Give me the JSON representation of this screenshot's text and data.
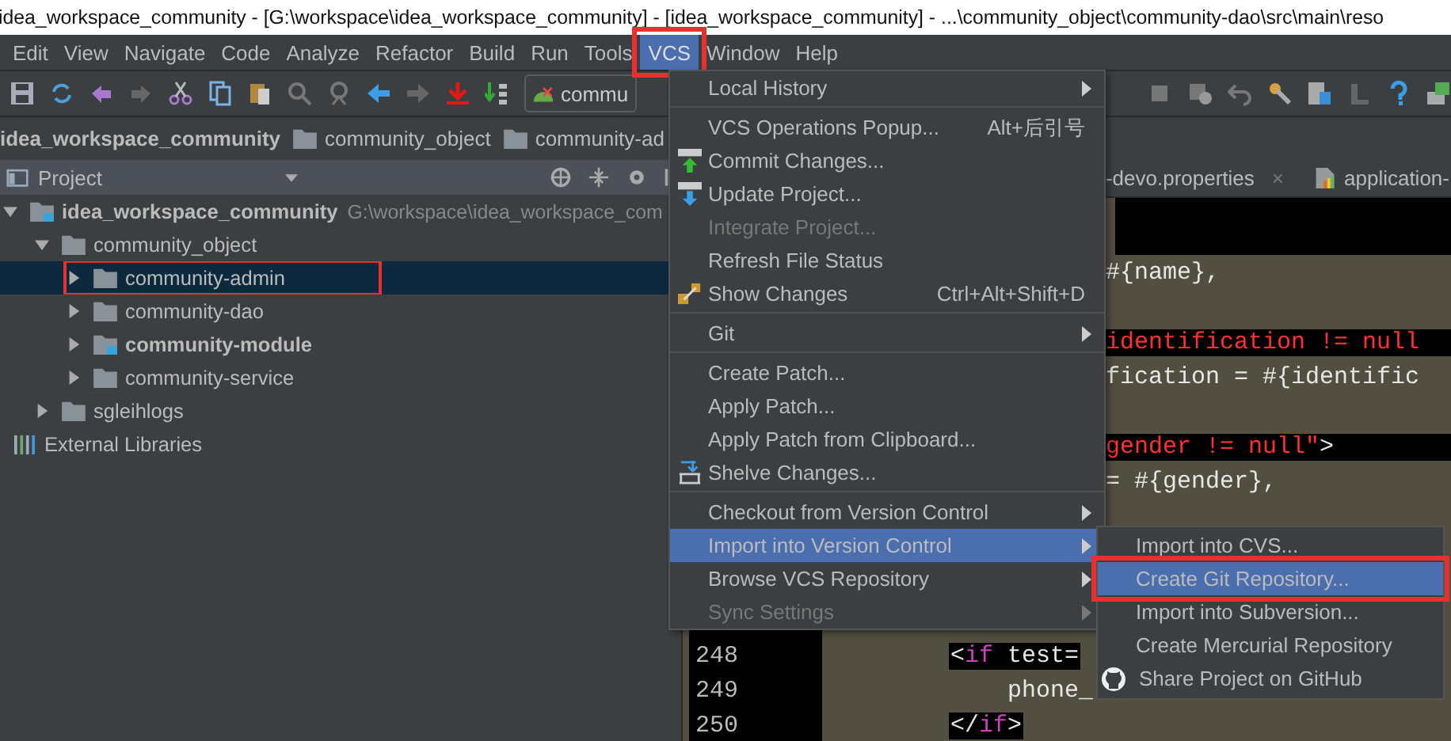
{
  "window": {
    "title": "idea_workspace_community - [G:\\workspace\\idea_workspace_community] - [idea_workspace_community] - ...\\community_object\\community-dao\\src\\main\\reso"
  },
  "menu_bar": [
    {
      "label": "Edit",
      "selected": false,
      "annotated": false
    },
    {
      "label": "View",
      "selected": false,
      "annotated": false
    },
    {
      "label": "Navigate",
      "selected": false,
      "annotated": false
    },
    {
      "label": "Code",
      "selected": false,
      "annotated": false
    },
    {
      "label": "Analyze",
      "selected": false,
      "annotated": false
    },
    {
      "label": "Refactor",
      "selected": false,
      "annotated": false
    },
    {
      "label": "Build",
      "selected": false,
      "annotated": false
    },
    {
      "label": "Run",
      "selected": false,
      "annotated": false
    },
    {
      "label": "Tools",
      "selected": false,
      "annotated": false
    },
    {
      "label": "VCS",
      "selected": true,
      "annotated": true
    },
    {
      "label": "Window",
      "selected": false,
      "annotated": false
    },
    {
      "label": "Help",
      "selected": false,
      "annotated": false
    }
  ],
  "toolbar": {
    "run_config": "commu"
  },
  "breadcrumb": [
    {
      "label": "idea_workspace_community",
      "kind": "project"
    },
    {
      "label": "community_object",
      "kind": "folder"
    },
    {
      "label": "community-ad",
      "kind": "folder"
    }
  ],
  "project_panel": {
    "title": "Project",
    "tree": [
      {
        "label": "idea_workspace_community",
        "path": "G:\\workspace\\idea_workspace_com",
        "kind": "module",
        "bold": true,
        "expanded": true,
        "selected": false,
        "annotated": false,
        "children": [
          {
            "label": "community_object",
            "kind": "folder",
            "bold": false,
            "expanded": true,
            "selected": false,
            "annotated": false,
            "children": [
              {
                "label": "community-admin",
                "kind": "folder",
                "bold": false,
                "expanded": false,
                "selected": true,
                "annotated": true
              },
              {
                "label": "community-dao",
                "kind": "folder",
                "bold": false,
                "expanded": false,
                "selected": false,
                "annotated": false
              },
              {
                "label": "community-module",
                "kind": "module",
                "bold": true,
                "expanded": false,
                "selected": false,
                "annotated": false
              },
              {
                "label": "community-service",
                "kind": "folder",
                "bold": false,
                "expanded": false,
                "selected": false,
                "annotated": false
              }
            ]
          },
          {
            "label": "sgleihlogs",
            "kind": "folder",
            "bold": false,
            "expanded": false,
            "selected": false,
            "annotated": false
          }
        ]
      },
      {
        "label": "External Libraries",
        "kind": "library",
        "bold": false,
        "selected": false,
        "annotated": false
      }
    ]
  },
  "editor": {
    "tabs": [
      {
        "label": "-devo.properties",
        "close": "×",
        "selected": false
      },
      {
        "label": "application-",
        "selected": false
      }
    ],
    "lines": [
      {
        "kind": "band"
      },
      {
        "kind": "tail",
        "highlight": false,
        "segments": [
          {
            "text": "#{name},",
            "kind": "plain"
          }
        ]
      },
      {
        "kind": "blank"
      },
      {
        "kind": "tail",
        "highlight": true,
        "segments": [
          {
            "text": "identification != null",
            "kind": "string"
          }
        ]
      },
      {
        "kind": "tail",
        "highlight": false,
        "segments": [
          {
            "text": "fication = #{identific",
            "kind": "plain"
          }
        ]
      },
      {
        "kind": "blank"
      },
      {
        "kind": "tail",
        "highlight": true,
        "segments": [
          {
            "text": "gender != null\"",
            "kind": "string"
          },
          {
            "text": ">",
            "kind": "plain"
          }
        ]
      },
      {
        "kind": "tail",
        "highlight": false,
        "segments": [
          {
            "text": " = #{gender},",
            "kind": "plain"
          }
        ]
      },
      {
        "kind": "blank"
      },
      {
        "kind": "blank"
      },
      {
        "kind": "blank"
      },
      {
        "kind": "blank"
      },
      {
        "kind": "tag",
        "number": "248",
        "highlight": true,
        "segments": [
          {
            "text": "<",
            "kind": "plain"
          },
          {
            "text": "if",
            "kind": "keyword"
          },
          {
            "text": " test=",
            "kind": "plain"
          }
        ]
      },
      {
        "kind": "body",
        "number": "249",
        "highlight": false,
        "segments": [
          {
            "text": "phone_",
            "kind": "plain"
          }
        ]
      },
      {
        "kind": "tag",
        "number": "250",
        "highlight": true,
        "segments": [
          {
            "text": "</",
            "kind": "plain"
          },
          {
            "text": "if",
            "kind": "keyword"
          },
          {
            "text": ">",
            "kind": "plain"
          }
        ]
      }
    ]
  },
  "vcs_menu": [
    {
      "kind": "item",
      "label": "Local History",
      "submenu": true,
      "disabled": false,
      "selected": false
    },
    {
      "kind": "separator"
    },
    {
      "kind": "item",
      "label": "VCS Operations Popup...",
      "shortcut": "Alt+后引号",
      "submenu": false,
      "disabled": false,
      "selected": false
    },
    {
      "kind": "commit",
      "label": "Commit Changes...",
      "submenu": false,
      "disabled": false,
      "selected": false
    },
    {
      "kind": "update",
      "label": "Update Project...",
      "submenu": false,
      "disabled": false,
      "selected": false
    },
    {
      "kind": "item",
      "label": "Integrate Project...",
      "submenu": false,
      "disabled": true,
      "selected": false
    },
    {
      "kind": "item",
      "label": "Refresh File Status",
      "submenu": false,
      "disabled": false,
      "selected": false
    },
    {
      "kind": "changes",
      "label": "Show Changes",
      "shortcut": "Ctrl+Alt+Shift+D",
      "submenu": false,
      "disabled": false,
      "selected": false
    },
    {
      "kind": "separator"
    },
    {
      "kind": "item",
      "label": "Git",
      "submenu": true,
      "disabled": false,
      "selected": false
    },
    {
      "kind": "separator"
    },
    {
      "kind": "item",
      "label": "Create Patch...",
      "submenu": false,
      "disabled": false,
      "selected": false
    },
    {
      "kind": "item",
      "label": "Apply Patch...",
      "submenu": false,
      "disabled": false,
      "selected": false
    },
    {
      "kind": "item",
      "label": "Apply Patch from Clipboard...",
      "submenu": false,
      "disabled": false,
      "selected": false
    },
    {
      "kind": "shelve",
      "label": "Shelve Changes...",
      "submenu": false,
      "disabled": false,
      "selected": false
    },
    {
      "kind": "separator"
    },
    {
      "kind": "item",
      "label": "Checkout from Version Control",
      "submenu": true,
      "disabled": false,
      "selected": false
    },
    {
      "kind": "item",
      "label": "Import into Version Control",
      "submenu": true,
      "disabled": false,
      "selected": true
    },
    {
      "kind": "item",
      "label": "Browse VCS Repository",
      "submenu": true,
      "disabled": false,
      "selected": false
    },
    {
      "kind": "item",
      "label": "Sync Settings",
      "submenu": true,
      "disabled": true,
      "selected": false
    }
  ],
  "import_submenu": [
    {
      "kind": "item",
      "label": "Import into CVS...",
      "selected": false,
      "annotated": false
    },
    {
      "kind": "item",
      "label": "Create Git Repository...",
      "selected": true,
      "annotated": true
    },
    {
      "kind": "item",
      "label": "Import into Subversion...",
      "selected": false,
      "annotated": false
    },
    {
      "kind": "item",
      "label": "Create Mercurial Repository",
      "selected": false,
      "annotated": false
    },
    {
      "kind": "github",
      "label": "Share Project on GitHub",
      "selected": false,
      "annotated": false
    }
  ]
}
